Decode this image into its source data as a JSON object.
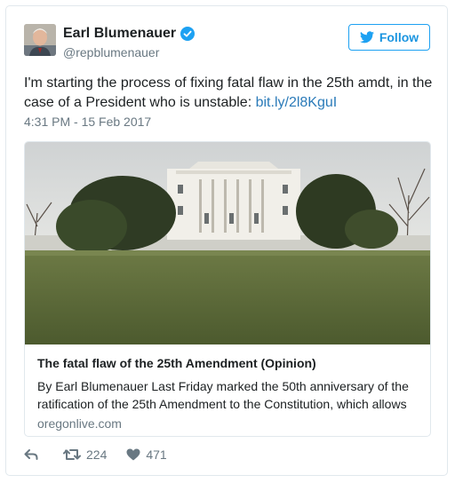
{
  "tweet": {
    "author_name": "Earl Blumenauer",
    "author_handle": "@repblumenauer",
    "follow_label": "Follow",
    "text_main": "I'm starting the process of fixing fatal flaw in the 25th amdt, in the case of a President who is unstable: ",
    "link_text": "bit.ly/2l8KguI",
    "timestamp": "4:31 PM - 15 Feb 2017"
  },
  "link_card": {
    "title": "The fatal flaw of the 25th Amendment (Opinion)",
    "description": "By Earl Blumenauer Last Friday marked the 50th anniversary of the ratification of the 25th Amendment to the Constitution, which allows",
    "domain": "oregonlive.com"
  },
  "actions": {
    "retweet_count": "224",
    "like_count": "471"
  },
  "colors": {
    "twitter_blue": "#1da1f2",
    "link": "#2b7bb9",
    "secondary_text": "#697882",
    "border": "#e1e8ed"
  },
  "icons": [
    "verified-badge-icon",
    "twitter-bird-icon",
    "reply-icon",
    "retweet-icon",
    "heart-icon"
  ]
}
